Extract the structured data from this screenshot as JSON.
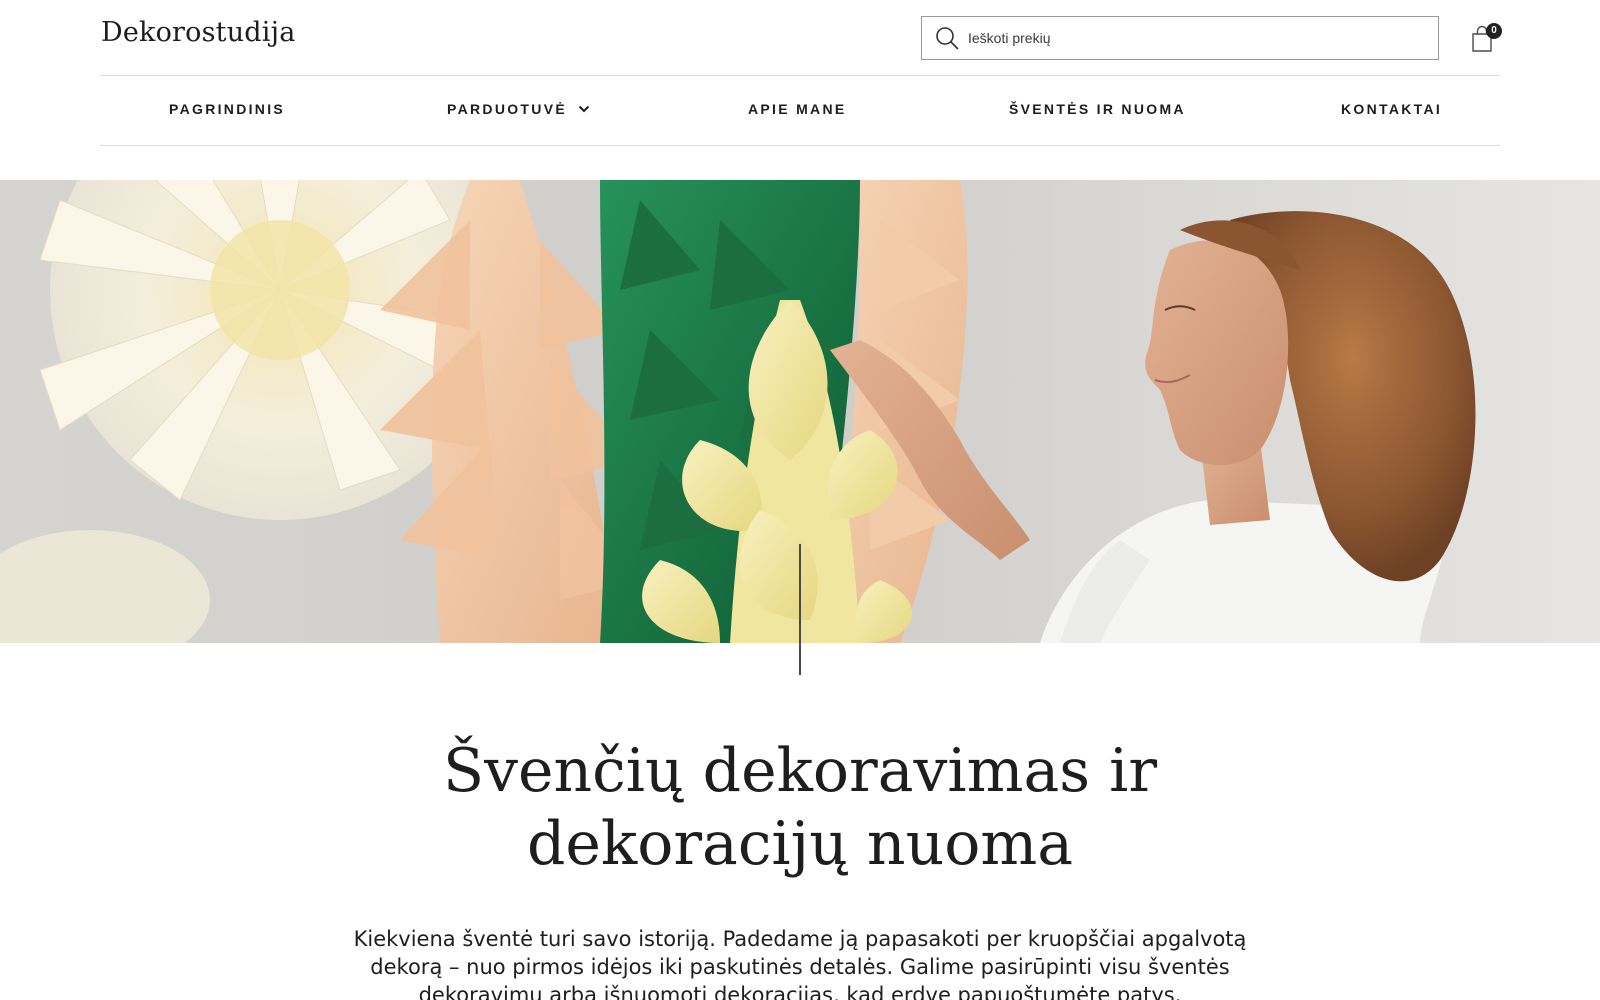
{
  "header": {
    "logo": "Dekorostudija",
    "search_placeholder": "Ieškoti prekių",
    "cart_count": "0"
  },
  "nav": {
    "items": [
      {
        "label": "PAGRINDINIS"
      },
      {
        "label": "PARDUOTUVĖ"
      },
      {
        "label": "APIE MANE"
      },
      {
        "label": "ŠVENTĖS IR NUOMA"
      },
      {
        "label": "KONTAKTAI"
      }
    ]
  },
  "hero": {
    "image": "hero-photo"
  },
  "main": {
    "title_line1": "Švenčių dekoravimas ir",
    "title_line2": "dekoracijų nuoma",
    "lead": "Kiekviena šventė turi savo istoriją. Padedame ją papasakoti per kruopščiai apgalvotą dekorą – nuo pirmos idėjos iki paskutinės detalės. Galime pasirūpinti visu šventės dekoravimu arba išnuomoti dekoracijas, kad erdvę papuoštumėte patys."
  },
  "colors": {
    "text": "#1e1e1e",
    "border": "#9a9a9a",
    "rule": "#dcdcdc",
    "peach": "#f0c8a6",
    "green": "#1f7a45",
    "yellow": "#f1e7a4",
    "cream": "#f3ecd9"
  }
}
